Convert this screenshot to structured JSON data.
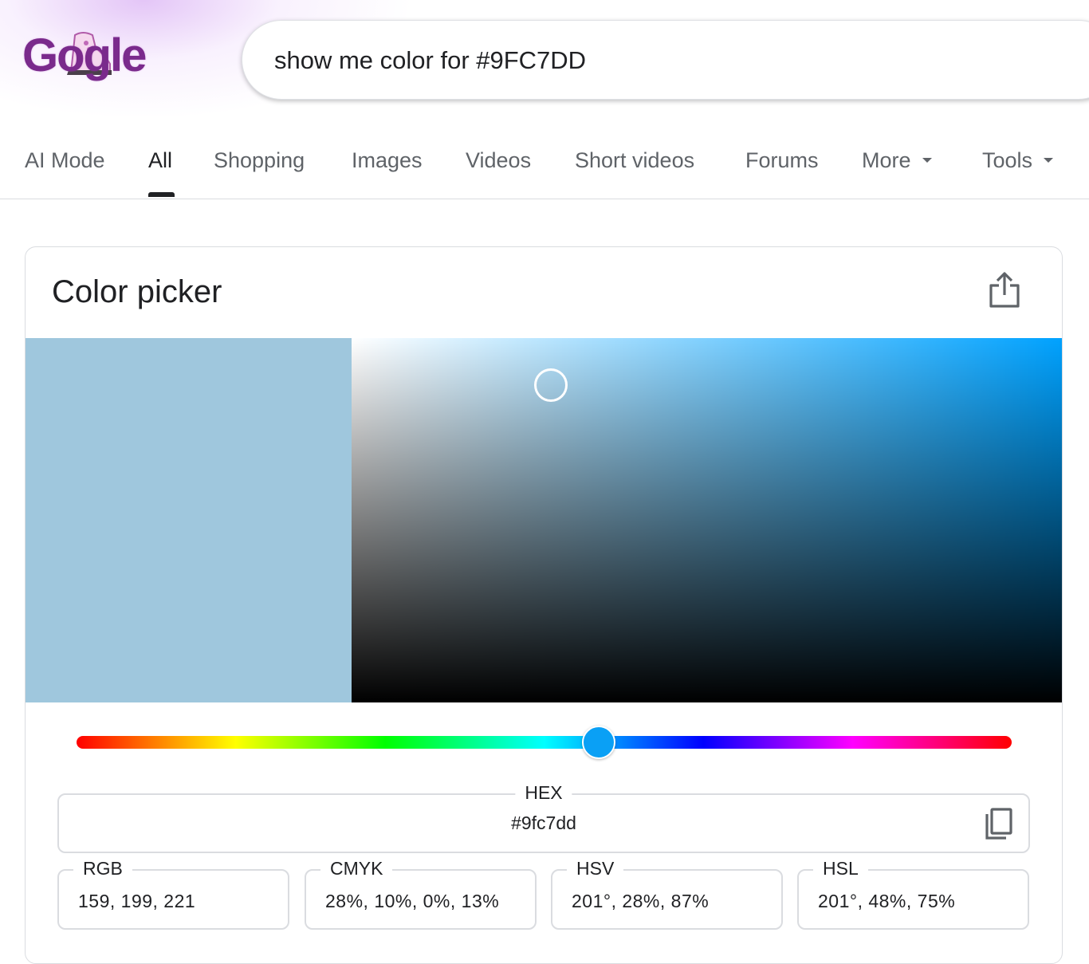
{
  "logo": {
    "text": "Gogle"
  },
  "search": {
    "query": "show me color for #9FC7DD"
  },
  "tabs": [
    {
      "label": "AI Mode"
    },
    {
      "label": "All"
    },
    {
      "label": "Shopping"
    },
    {
      "label": "Images"
    },
    {
      "label": "Videos"
    },
    {
      "label": "Short videos"
    },
    {
      "label": "Forums"
    },
    {
      "label": "More"
    },
    {
      "label": "Tools"
    }
  ],
  "active_tab": "All",
  "card": {
    "title": "Color picker",
    "share_icon": "share-icon",
    "copy_icon": "copy-icon"
  },
  "color": {
    "swatch": "#9fc7dd",
    "hue_color": "#00a2ff",
    "thumb_color": "#0aa0f5",
    "hue_deg": 201,
    "saturation_pct": 28,
    "value_pct": 87
  },
  "hex": {
    "label": "HEX",
    "value": "#9fc7dd"
  },
  "models": [
    {
      "label": "RGB",
      "value": "159, 199, 221"
    },
    {
      "label": "CMYK",
      "value": "28%, 10%, 0%, 13%"
    },
    {
      "label": "HSV",
      "value": "201°, 28%, 87%"
    },
    {
      "label": "HSL",
      "value": "201°, 48%, 75%"
    }
  ]
}
